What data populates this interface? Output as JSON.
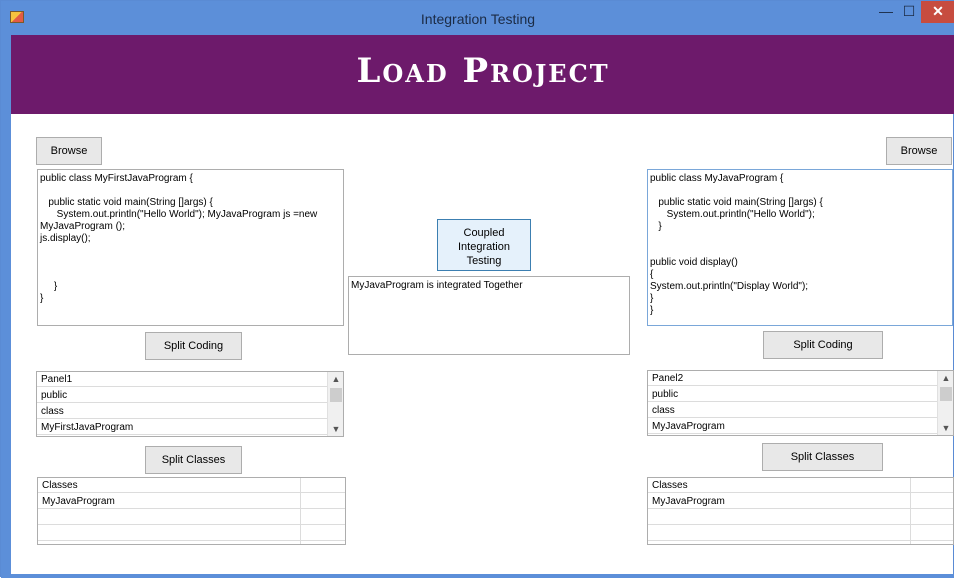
{
  "window": {
    "title": "Integration Testing",
    "minimize": "—",
    "maximize": "☐",
    "close": "✕"
  },
  "banner": {
    "title": "Load Project"
  },
  "left": {
    "browse": "Browse",
    "code": "public class MyFirstJavaProgram {\n\n   public static void main(String []args) {\n      System.out.println(\"Hello World\"); MyJavaProgram js =new\nMyJavaProgram ();\njs.display();\n\n\n\n     }\n}",
    "split_coding": "Split Coding",
    "panel": {
      "header": "Panel1",
      "items": [
        "public",
        "class",
        "MyFirstJavaProgram"
      ]
    },
    "split_classes": "Split Classes",
    "classes": {
      "header": "Classes",
      "items": [
        "MyJavaProgram"
      ]
    }
  },
  "center": {
    "coupled_button": "Coupled\nIntegration\nTesting",
    "result": "MyJavaProgram is integrated Together"
  },
  "right": {
    "browse": "Browse",
    "code": "public class MyJavaProgram {\n\n   public static void main(String []args) {\n      System.out.println(\"Hello World\");\n   }\n\n\npublic void display()\n{\nSystem.out.println(\"Display World\");\n}\n}",
    "split_coding": "Split Coding",
    "panel": {
      "header": "Panel2",
      "items": [
        "public",
        "class",
        "MyJavaProgram"
      ]
    },
    "split_classes": "Split Classes",
    "classes": {
      "header": "Classes",
      "items": [
        "MyJavaProgram"
      ]
    }
  }
}
